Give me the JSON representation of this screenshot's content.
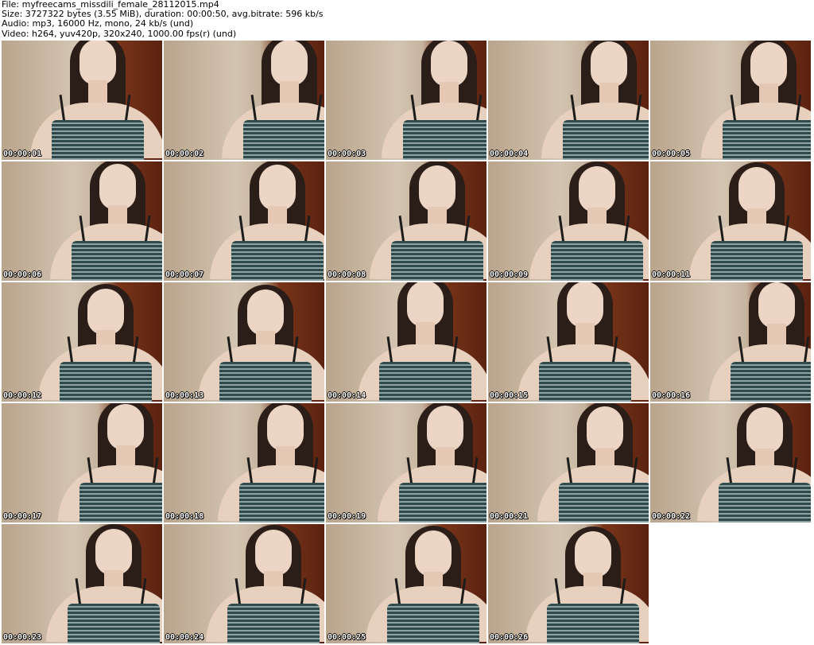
{
  "header": {
    "file_line": "File: myfreecams_missdili_female_28112015.mp4",
    "size_line": "Size: 3727322 bytes (3.55 MiB), duration: 00:00:50, avg.bitrate: 596 kb/s",
    "audio_line": "Audio: mp3, 16000 Hz, mono, 24 kb/s (und)",
    "video_line": "Video: h264, yuv420p, 320x240, 1000.00 fps(r) (und)"
  },
  "thumbnails": [
    {
      "timestamp": "00:00:01"
    },
    {
      "timestamp": "00:00:02"
    },
    {
      "timestamp": "00:00:03"
    },
    {
      "timestamp": "00:00:04"
    },
    {
      "timestamp": "00:00:05"
    },
    {
      "timestamp": "00:00:06"
    },
    {
      "timestamp": "00:00:07"
    },
    {
      "timestamp": "00:00:08"
    },
    {
      "timestamp": "00:00:09"
    },
    {
      "timestamp": "00:00:11"
    },
    {
      "timestamp": "00:00:12"
    },
    {
      "timestamp": "00:00:13"
    },
    {
      "timestamp": "00:00:14"
    },
    {
      "timestamp": "00:00:15"
    },
    {
      "timestamp": "00:00:16"
    },
    {
      "timestamp": "00:00:17"
    },
    {
      "timestamp": "00:00:18"
    },
    {
      "timestamp": "00:00:19"
    },
    {
      "timestamp": "00:00:21"
    },
    {
      "timestamp": "00:00:22"
    },
    {
      "timestamp": "00:00:23"
    },
    {
      "timestamp": "00:00:24"
    },
    {
      "timestamp": "00:00:25"
    },
    {
      "timestamp": "00:00:26"
    }
  ]
}
